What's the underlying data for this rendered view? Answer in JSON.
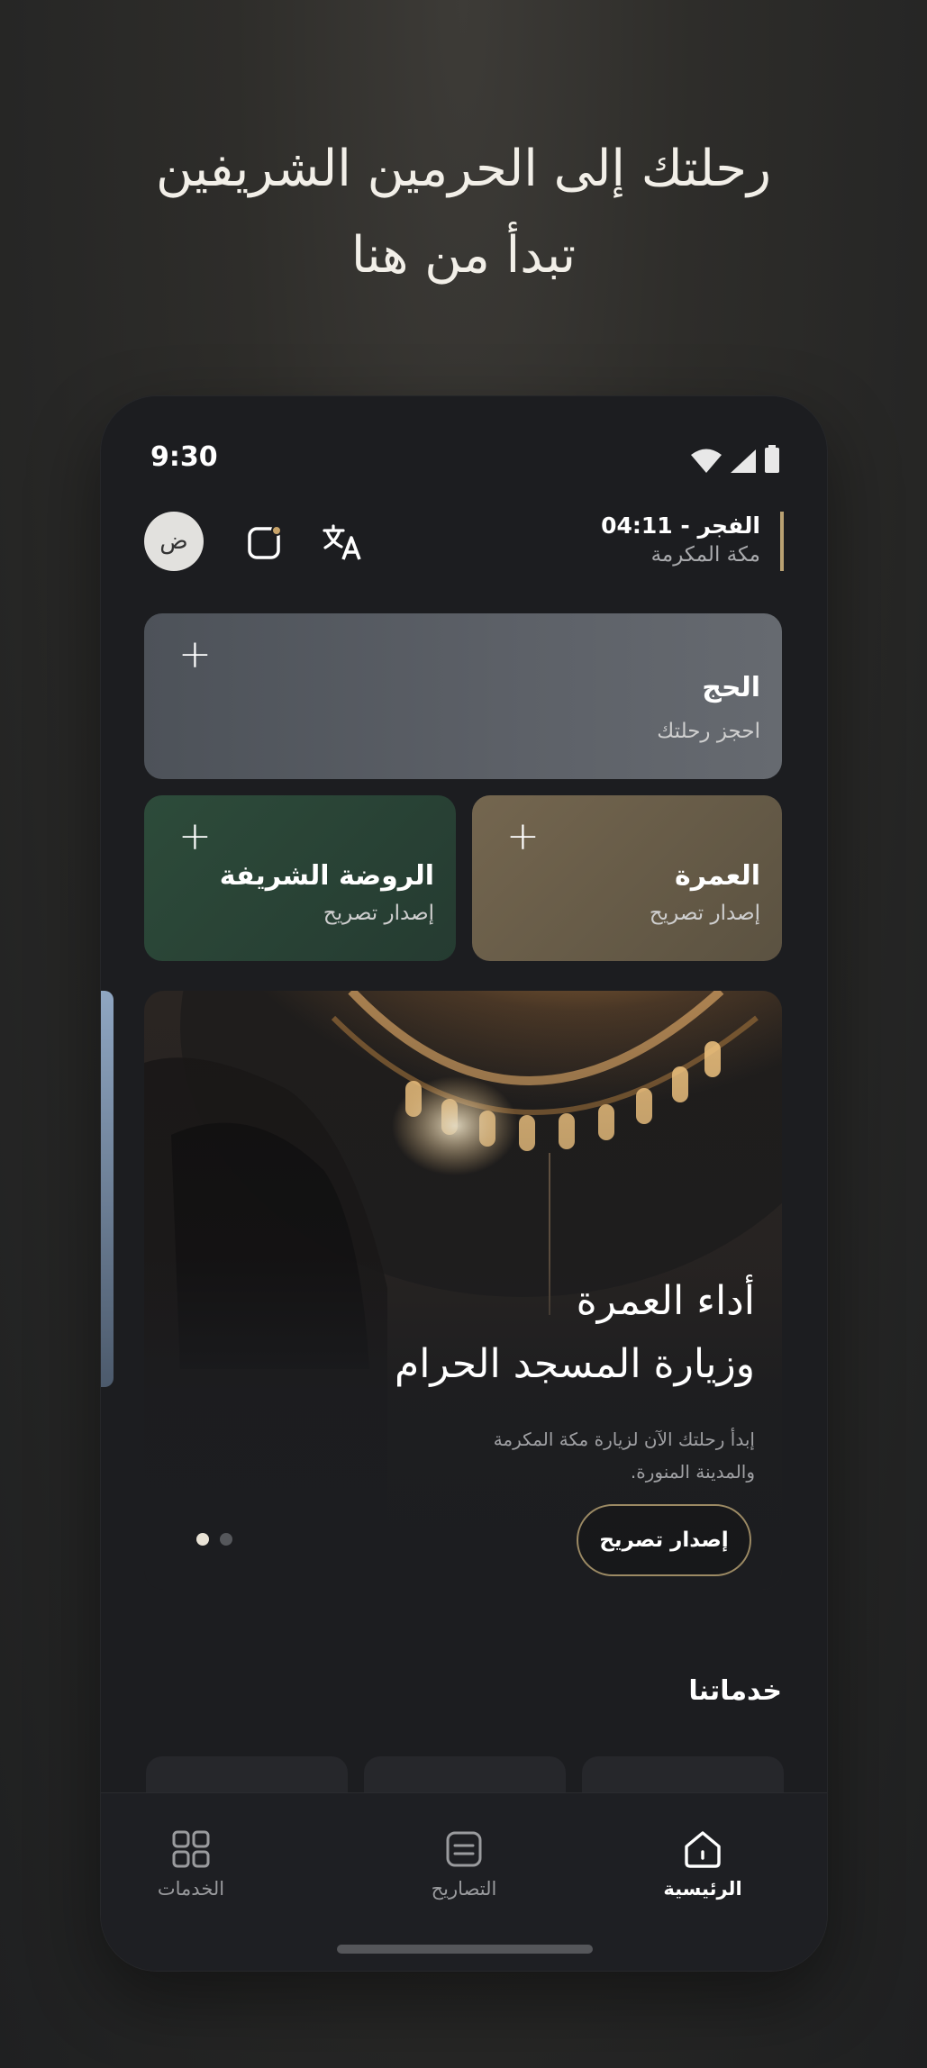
{
  "headline": {
    "line1": "رحلتك إلى الحرمين الشريفين",
    "line2": "تبدأ من هنا"
  },
  "status_bar": {
    "time": "9:30"
  },
  "header": {
    "avatar_letter": "ض",
    "prayer_title": "الفجر - 04:11",
    "prayer_city": "مكة المكرمة",
    "icons": [
      "notification-icon",
      "translate-icon"
    ]
  },
  "cards": {
    "hajj": {
      "title": "الحج",
      "subtitle": "احجز رحلتك",
      "action": "+"
    },
    "umrah": {
      "title": "العمرة",
      "subtitle": "إصدار تصريح",
      "action": "+"
    },
    "rawdah": {
      "title": "الروضة الشريفة",
      "subtitle": "إصدار تصريح",
      "action": "+"
    }
  },
  "banner": {
    "title_line1": "أداء العمرة",
    "title_line2": "وزيارة المسجد الحرام",
    "description": "إبدأ رحلتك الآن لزيارة مكة المكرمة والمدينة المنورة.",
    "button_label": "إصدار تصريح",
    "carousel": {
      "count": 2,
      "active_index": 1
    }
  },
  "services": {
    "title": "خدماتنا"
  },
  "tabbar": {
    "items": [
      {
        "label": "الرئيسية",
        "icon": "home-icon",
        "active": true
      },
      {
        "label": "التصاريح",
        "icon": "permits-icon",
        "active": false
      },
      {
        "label": "الخدمات",
        "icon": "services-grid-icon",
        "active": false
      }
    ]
  },
  "colors": {
    "accent": "#b9a172",
    "background": "#1c1d20"
  }
}
